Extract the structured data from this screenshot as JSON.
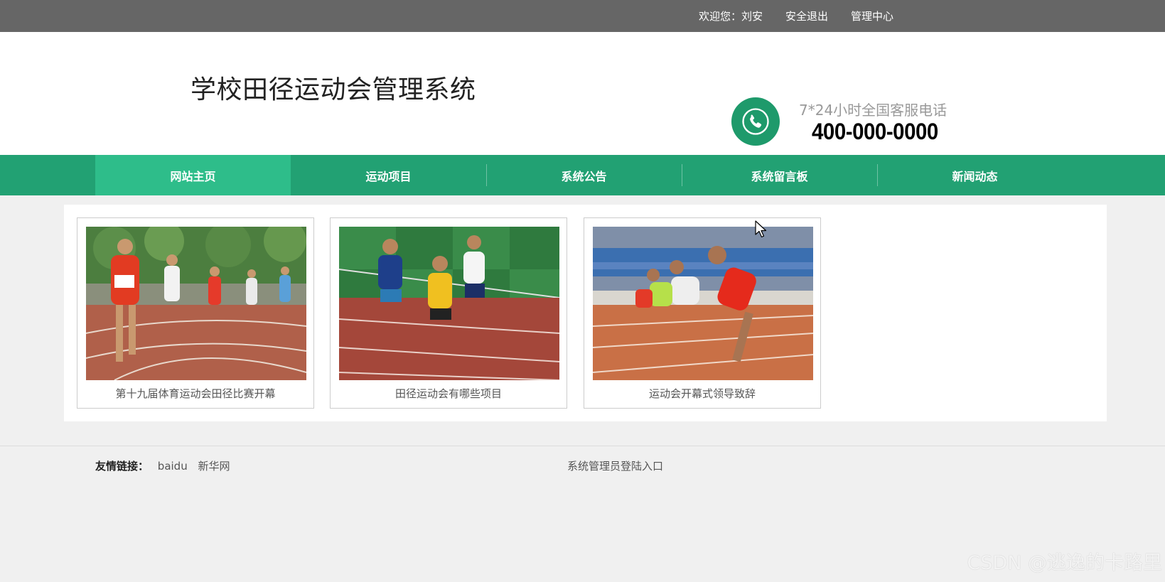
{
  "topbar": {
    "welcome": "欢迎您：刘安",
    "logout": "安全退出",
    "admin_center": "管理中心"
  },
  "header": {
    "title": "学校田径运动会管理系统",
    "service_label": "7*24小时全国客服电话",
    "service_phone": "400-000-0000",
    "icon": "phone-icon"
  },
  "nav": {
    "items": [
      {
        "label": "网站主页",
        "active": true
      },
      {
        "label": "运动项目",
        "active": false
      },
      {
        "label": "系统公告",
        "active": false
      },
      {
        "label": "系统留言板",
        "active": false
      },
      {
        "label": "新闻动态",
        "active": false
      }
    ]
  },
  "news": [
    {
      "caption": "第十九届体育运动会田径比赛开幕"
    },
    {
      "caption": "田径运动会有哪些项目"
    },
    {
      "caption": "运动会开幕式领导致辞"
    }
  ],
  "footer": {
    "friend_links_label": "友情链接：",
    "friend_links": [
      "baidu",
      "新华网"
    ],
    "admin_entry": "系统管理员登陆入口"
  },
  "watermark": "CSDN @逃逸的卡路里",
  "colors": {
    "topbar": "#666666",
    "nav": "#22a173",
    "nav_active": "#2ebd8a",
    "phone_icon": "#1e9a6b"
  }
}
